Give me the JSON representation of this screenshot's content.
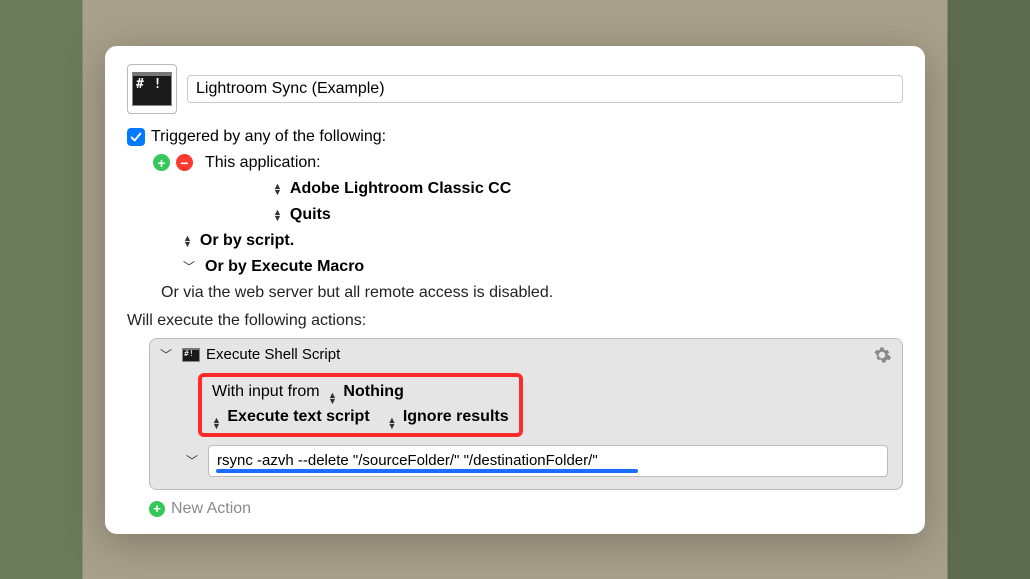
{
  "macro": {
    "name": "Lightroom Sync (Example)"
  },
  "trigger": {
    "header": "Triggered by any of the following:",
    "app_label": "This application:",
    "app_name": "Adobe Lightroom Classic CC",
    "app_event": "Quits",
    "by_script": "Or by script.",
    "by_macro": "Or by Execute Macro",
    "web_note": "Or via the web server but all remote access is disabled."
  },
  "actions_header": "Will execute the following actions:",
  "action": {
    "title": "Execute Shell Script",
    "input_label": "With input from",
    "input_value": "Nothing",
    "script_mode": "Execute text script",
    "results_mode": "Ignore results",
    "script_text": "rsync -azvh --delete \"/sourceFolder/\" \"/destinationFolder/\""
  },
  "new_action_label": "New Action"
}
